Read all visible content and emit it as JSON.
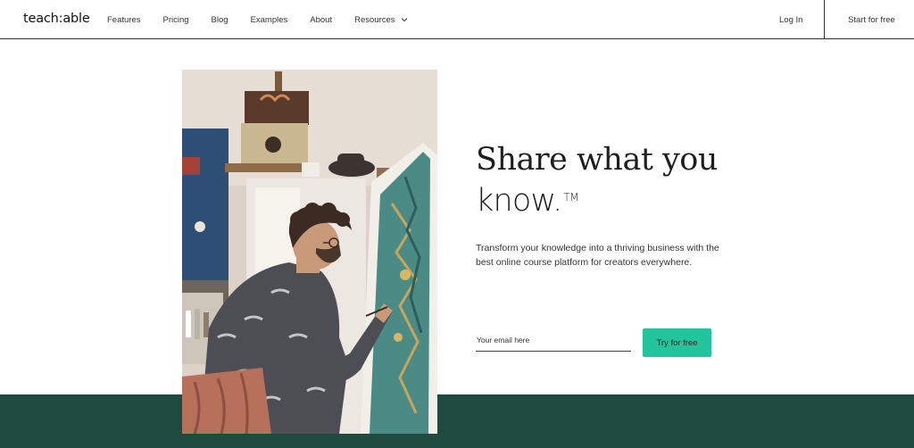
{
  "brand": {
    "logo": "teach:able"
  },
  "nav": {
    "links": [
      "Features",
      "Pricing",
      "Blog",
      "Examples",
      "About",
      "Resources"
    ],
    "login": "Log In",
    "start": "Start for free"
  },
  "hero": {
    "headline_line1": "Share what you",
    "headline_line2": "know.",
    "trademark": "TM",
    "subtext": "Transform your knowledge into a thriving business with the best online course platform for creators everywhere.",
    "email_placeholder": "Your email here",
    "cta_label": "Try for free",
    "image": "artist-painting-canvas-photo"
  },
  "colors": {
    "accent": "#22c59b",
    "band": "#1f4a3f",
    "text": "#1e1e1e"
  }
}
